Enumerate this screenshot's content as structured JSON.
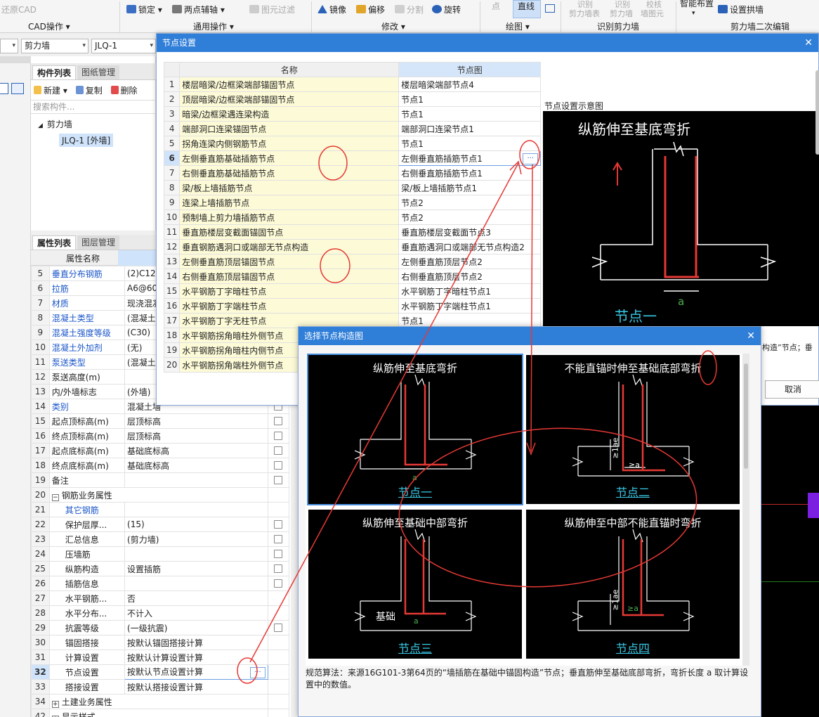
{
  "ribbon": {
    "restore_cad": "还原CAD",
    "cad_ops": "CAD操作",
    "lock": "锁定",
    "two_point_axis": "两点辅轴",
    "layer_filter": "图元过滤",
    "general_ops": "通用操作",
    "mirror": "镜像",
    "offset": "偏移",
    "split": "分割",
    "rotate": "旋转",
    "modify": "修改",
    "point": "点",
    "line": "直线",
    "draw": "绘图",
    "identify_wall_table_1": "识别",
    "identify_wall_table_2": "剪力墙表",
    "identify_wall_1": "识别",
    "identify_wall_2": "剪力墙",
    "check_wall_1": "校核",
    "check_wall_2": "墙图元",
    "identify_group": "识别剪力墙",
    "smart_layout": "智能布置",
    "set_arch": "设置拱墙",
    "secondary_edit": "剪力墙二次编辑"
  },
  "selectors": {
    "type": "剪力墙",
    "name": "JLQ-1"
  },
  "component_panel": {
    "tab_list": "构件列表",
    "tab_drawings": "图纸管理",
    "new": "新建",
    "copy": "复制",
    "delete": "删除",
    "search_placeholder": "搜索构件...",
    "tree_root": "剪力墙",
    "tree_child": "JLQ-1 [外墙]"
  },
  "property_panel": {
    "tab_props": "属性列表",
    "tab_layers": "图层管理",
    "col_name": "属性名称",
    "rows": [
      {
        "n": "5",
        "k": "垂直分布钢筋",
        "v": "(2)C12@",
        "blue": true,
        "chk": false
      },
      {
        "n": "6",
        "k": "拉筋",
        "v": "A6@600",
        "blue": true,
        "chk": false
      },
      {
        "n": "7",
        "k": "材质",
        "v": "现浇混凝",
        "blue": true,
        "chk": false
      },
      {
        "n": "8",
        "k": "混凝土类型",
        "v": "(混凝土2",
        "blue": true,
        "chk": false
      },
      {
        "n": "9",
        "k": "混凝土强度等级",
        "v": "(C30)",
        "blue": true,
        "chk": false
      },
      {
        "n": "10",
        "k": "混凝土外加剂",
        "v": "(无)",
        "blue": true,
        "chk": false
      },
      {
        "n": "11",
        "k": "泵送类型",
        "v": "(混凝土泵",
        "blue": true,
        "chk": false
      },
      {
        "n": "12",
        "k": "泵送高度(m)",
        "v": "",
        "blue": false,
        "chk": false
      },
      {
        "n": "13",
        "k": "内/外墙标志",
        "v": "(外墙)",
        "blue": false,
        "chk": false
      },
      {
        "n": "14",
        "k": "类别",
        "v": "混凝土墙",
        "blue": true,
        "chk": true
      },
      {
        "n": "15",
        "k": "起点顶标高(m)",
        "v": "层顶标高",
        "blue": false,
        "chk": true
      },
      {
        "n": "16",
        "k": "终点顶标高(m)",
        "v": "层顶标高",
        "blue": false,
        "chk": true
      },
      {
        "n": "17",
        "k": "起点底标高(m)",
        "v": "基础底标高",
        "blue": false,
        "chk": true
      },
      {
        "n": "18",
        "k": "终点底标高(m)",
        "v": "基础底标高",
        "blue": false,
        "chk": true
      },
      {
        "n": "19",
        "k": "备注",
        "v": "",
        "blue": false,
        "chk": true
      },
      {
        "n": "20",
        "k": "钢筋业务属性",
        "v": "",
        "blue": false,
        "chk": false,
        "group": "−"
      },
      {
        "n": "21",
        "k": "其它钢筋",
        "v": "",
        "blue": true,
        "chk": false,
        "indent": true
      },
      {
        "n": "22",
        "k": "保护层厚...",
        "v": "(15)",
        "blue": false,
        "chk": true,
        "indent": true
      },
      {
        "n": "23",
        "k": "汇总信息",
        "v": "(剪力墙)",
        "blue": false,
        "chk": true,
        "indent": true
      },
      {
        "n": "24",
        "k": "压墙筋",
        "v": "",
        "blue": false,
        "chk": true,
        "indent": true
      },
      {
        "n": "25",
        "k": "纵筋构造",
        "v": "设置插筋",
        "blue": false,
        "chk": true,
        "indent": true
      },
      {
        "n": "26",
        "k": "插筋信息",
        "v": "",
        "blue": false,
        "chk": true,
        "indent": true
      },
      {
        "n": "27",
        "k": "水平钢筋...",
        "v": "否",
        "blue": false,
        "chk": false,
        "indent": true
      },
      {
        "n": "28",
        "k": "水平分布...",
        "v": "不计入",
        "blue": false,
        "chk": false,
        "indent": true
      },
      {
        "n": "29",
        "k": "抗震等级",
        "v": "(一级抗震)",
        "blue": false,
        "chk": true,
        "indent": true
      },
      {
        "n": "30",
        "k": "锚固搭接",
        "v": "按默认锚固搭接计算",
        "blue": false,
        "chk": false,
        "indent": true
      },
      {
        "n": "31",
        "k": "计算设置",
        "v": "按默认计算设置计算",
        "blue": false,
        "chk": false,
        "indent": true
      },
      {
        "n": "32",
        "k": "节点设置",
        "v": "按默认节点设置计算",
        "blue": false,
        "chk": false,
        "indent": true,
        "cur": true
      },
      {
        "n": "33",
        "k": "搭接设置",
        "v": "按默认搭接设置计算",
        "blue": false,
        "chk": false,
        "indent": true
      },
      {
        "n": "34",
        "k": "土建业务属性",
        "v": "",
        "blue": false,
        "chk": false,
        "group": "+"
      },
      {
        "n": "42",
        "k": "显示样式",
        "v": "",
        "blue": false,
        "chk": false,
        "group": "+"
      }
    ]
  },
  "node_dialog": {
    "title": "节点设置",
    "col_name": "名称",
    "col_diagram": "节点图",
    "preview_label": "节点设置示意图",
    "preview_title": "纵筋伸至基底弯折",
    "preview_caption": "节点一",
    "preview_dim": "a",
    "side_text": "构造”节点；垂",
    "cancel": "取消",
    "rows": [
      {
        "i": "1",
        "name": "楼层暗梁/边框梁端部锚固节点",
        "val": "楼层暗梁端部节点4"
      },
      {
        "i": "2",
        "name": "顶层暗梁/边框梁端部锚固节点",
        "val": "节点1"
      },
      {
        "i": "3",
        "name": "暗梁/边框梁遇连梁构造",
        "val": "节点1"
      },
      {
        "i": "4",
        "name": "端部洞口连梁锚固节点",
        "val": "端部洞口连梁节点1"
      },
      {
        "i": "5",
        "name": "拐角连梁内侧钢筋节点",
        "val": "节点1"
      },
      {
        "i": "6",
        "name": "左侧垂直筋基础插筋节点",
        "val": "左侧垂直筋插筋节点1",
        "cur": true
      },
      {
        "i": "7",
        "name": "右侧垂直筋基础插筋节点",
        "val": "右侧垂直筋插筋节点1"
      },
      {
        "i": "8",
        "name": "梁/板上墙插筋节点",
        "val": "梁/板上墙插筋节点1"
      },
      {
        "i": "9",
        "name": "连梁上墙插筋节点",
        "val": "节点2"
      },
      {
        "i": "10",
        "name": "预制墙上剪力墙插筋节点",
        "val": "节点2"
      },
      {
        "i": "11",
        "name": "垂直筋楼层变截面锚固节点",
        "val": "垂直筋楼层变截面节点3"
      },
      {
        "i": "12",
        "name": "垂直钢筋遇洞口或端部无节点构造",
        "val": "垂直筋遇洞口或端部无节点构造2"
      },
      {
        "i": "13",
        "name": "左侧垂直筋顶层锚固节点",
        "val": "左侧垂直筋顶层节点2"
      },
      {
        "i": "14",
        "name": "右侧垂直筋顶层锚固节点",
        "val": "右侧垂直筋顶层节点2"
      },
      {
        "i": "15",
        "name": "水平钢筋丁字暗柱节点",
        "val": "水平钢筋丁字暗柱节点1"
      },
      {
        "i": "16",
        "name": "水平钢筋丁字端柱节点",
        "val": "水平钢筋丁字端柱节点1"
      },
      {
        "i": "17",
        "name": "水平钢筋丁字无柱节点",
        "val": "节点1"
      },
      {
        "i": "18",
        "name": "水平钢筋拐角暗柱外侧节点",
        "val": ""
      },
      {
        "i": "19",
        "name": "水平钢筋拐角暗柱内侧节点",
        "val": ""
      },
      {
        "i": "20",
        "name": "水平钢筋拐角端柱外侧节点",
        "val": ""
      }
    ]
  },
  "select_dialog": {
    "title": "选择节点构造图",
    "options": [
      {
        "title": "纵筋伸至基底弯折",
        "caption": "节点一",
        "selected": true
      },
      {
        "title": "不能直锚时伸至基础底部弯折",
        "caption": "节点二",
        "selected": false
      },
      {
        "title": "纵筋伸至基础中部弯折",
        "caption": "节点三",
        "selected": false
      },
      {
        "title": "纵筋伸至中部不能直锚时弯折",
        "caption": "节点四",
        "selected": false
      }
    ],
    "foundation_label": "基础",
    "lae_label": "≥1ae",
    "ge_a": "≥a",
    "dim_a": "a",
    "description": "规范算法：来源16G101-3第64页的“墙插筋在基础中锚固构造”节点；垂直筋伸至基础底部弯折，弯折长度 a 取计算设置中的数值。"
  },
  "colors": {
    "accent": "#2f7ed8",
    "annotation_red": "#e53935",
    "cyan_caption": "#39c9e6",
    "name_cell": "#fdfbd7"
  }
}
